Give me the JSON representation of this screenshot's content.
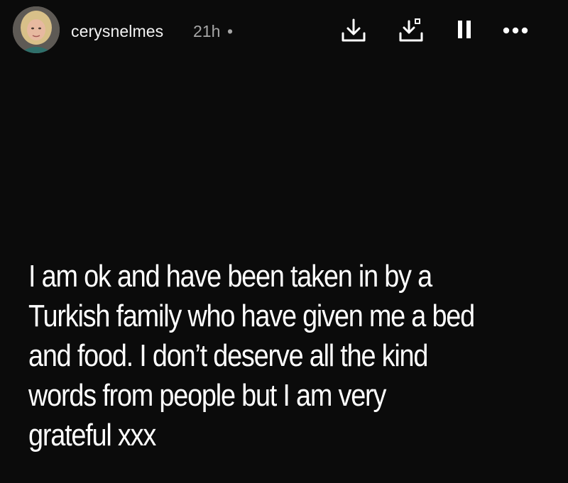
{
  "header": {
    "username": "cerysnelmes",
    "timestamp": "21h",
    "separator": "•",
    "icons": {
      "download": "download-icon",
      "save": "save-to-device-icon",
      "pause": "pause-icon",
      "more": "more-options-icon"
    }
  },
  "story": {
    "lines": [
      "I am ok and have been taken in by a",
      "Turkish family who have given me a bed",
      "and food. I don’t deserve all the kind",
      "words from people but I am very",
      "grateful xxx"
    ]
  },
  "colors": {
    "background": "#0b0b0b",
    "text": "#ffffff",
    "muted": "#a6a6a6"
  }
}
